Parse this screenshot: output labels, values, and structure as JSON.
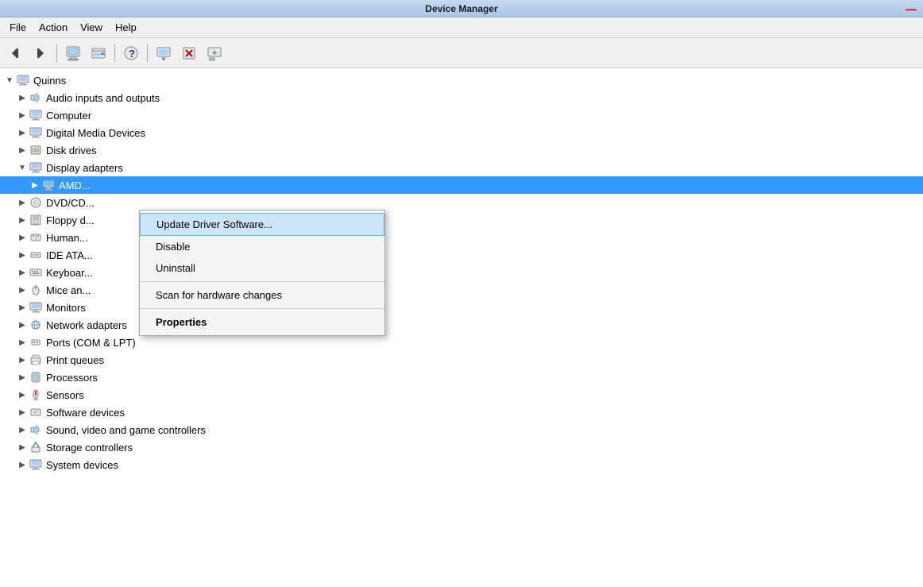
{
  "titleBar": {
    "title": "Device Manager",
    "closeLabel": "—"
  },
  "menuBar": {
    "items": [
      "File",
      "Action",
      "View",
      "Help"
    ]
  },
  "toolbar": {
    "buttons": [
      {
        "name": "back-btn",
        "icon": "◀",
        "interactable": true
      },
      {
        "name": "forward-btn",
        "icon": "▶",
        "interactable": true
      },
      {
        "name": "properties-btn",
        "icon": "🖥",
        "interactable": true
      },
      {
        "name": "update-driver-btn",
        "icon": "📄",
        "interactable": true
      },
      {
        "name": "help-btn",
        "icon": "❓",
        "interactable": true
      },
      {
        "name": "scan-btn",
        "icon": "🔍",
        "interactable": true
      },
      {
        "name": "uninstall-btn",
        "icon": "❌",
        "interactable": true
      },
      {
        "name": "add-btn",
        "icon": "➕",
        "interactable": true
      }
    ]
  },
  "tree": {
    "root": {
      "label": "Quinns",
      "icon": "💻",
      "expanded": true
    },
    "items": [
      {
        "label": "Audio inputs and outputs",
        "icon": "🔊",
        "level": 1,
        "expanded": false
      },
      {
        "label": "Computer",
        "icon": "🖥",
        "level": 1,
        "expanded": false
      },
      {
        "label": "Digital Media Devices",
        "icon": "📺",
        "level": 1,
        "expanded": false
      },
      {
        "label": "Disk drives",
        "icon": "💾",
        "level": 1,
        "expanded": false
      },
      {
        "label": "Display adapters",
        "icon": "🖥",
        "level": 1,
        "expanded": true
      },
      {
        "label": "AMD...",
        "icon": "🖥",
        "level": 2,
        "expanded": false,
        "selected": true
      },
      {
        "label": "DVD/CD...",
        "icon": "💿",
        "level": 1,
        "expanded": false
      },
      {
        "label": "Floppy d...",
        "icon": "💾",
        "level": 1,
        "expanded": false
      },
      {
        "label": "Human...",
        "icon": "⌨",
        "level": 1,
        "expanded": false
      },
      {
        "label": "IDE ATA...",
        "icon": "🔌",
        "level": 1,
        "expanded": false
      },
      {
        "label": "Keyboar...",
        "icon": "⌨",
        "level": 1,
        "expanded": false
      },
      {
        "label": "Mice an...",
        "icon": "🖱",
        "level": 1,
        "expanded": false
      },
      {
        "label": "Monitors",
        "icon": "🖥",
        "level": 1,
        "expanded": false
      },
      {
        "label": "Network adapters",
        "icon": "🌐",
        "level": 1,
        "expanded": false
      },
      {
        "label": "Ports (COM & LPT)",
        "icon": "🔌",
        "level": 1,
        "expanded": false
      },
      {
        "label": "Print queues",
        "icon": "🖨",
        "level": 1,
        "expanded": false
      },
      {
        "label": "Processors",
        "icon": "⚙",
        "level": 1,
        "expanded": false
      },
      {
        "label": "Sensors",
        "icon": "📡",
        "level": 1,
        "expanded": false
      },
      {
        "label": "Software devices",
        "icon": "📦",
        "level": 1,
        "expanded": false
      },
      {
        "label": "Sound, video and game controllers",
        "icon": "🔊",
        "level": 1,
        "expanded": false
      },
      {
        "label": "Storage controllers",
        "icon": "💾",
        "level": 1,
        "expanded": false
      },
      {
        "label": "System devices",
        "icon": "⚙",
        "level": 1,
        "expanded": false
      }
    ]
  },
  "contextMenu": {
    "items": [
      {
        "label": "Update Driver Software...",
        "type": "highlighted",
        "bold": false
      },
      {
        "label": "Disable",
        "type": "normal",
        "bold": false
      },
      {
        "label": "Uninstall",
        "type": "normal",
        "bold": false
      },
      {
        "type": "separator"
      },
      {
        "label": "Scan for hardware changes",
        "type": "normal",
        "bold": false
      },
      {
        "type": "separator"
      },
      {
        "label": "Properties",
        "type": "normal",
        "bold": true
      }
    ]
  },
  "icons": {
    "expand": "▷",
    "collapse": "▽",
    "expandFill": "▶",
    "collapseFill": "▼"
  }
}
